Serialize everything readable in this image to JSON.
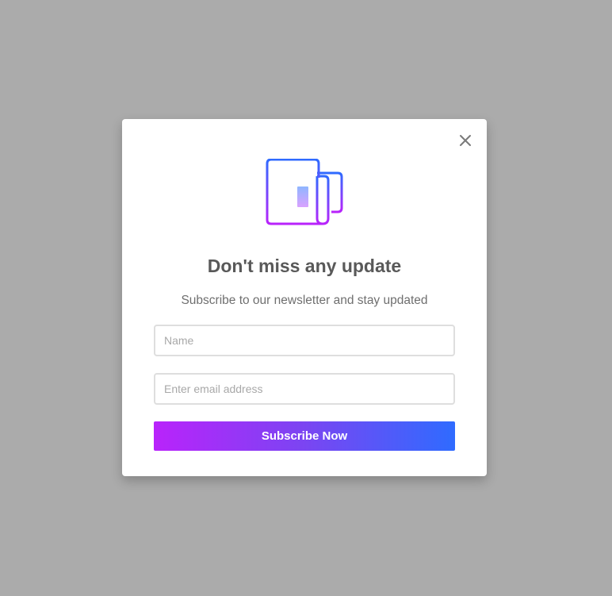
{
  "modal": {
    "close_icon": "close-icon",
    "hero_icon": "newspaper-icon",
    "title": "Don't miss any update",
    "subtitle": "Subscribe to our newsletter and stay updated",
    "name_input": {
      "placeholder": "Name",
      "value": ""
    },
    "email_input": {
      "placeholder": "Enter email address",
      "value": ""
    },
    "submit_label": "Subscribe Now"
  },
  "colors": {
    "backdrop": "#ababab",
    "modal_bg": "#ffffff",
    "title_text": "#595959",
    "subtitle_text": "#6f6f6f",
    "input_border": "#dedede",
    "gradient_start": "#b923fb",
    "gradient_end": "#2f6bff",
    "button_text": "#ffffff"
  }
}
